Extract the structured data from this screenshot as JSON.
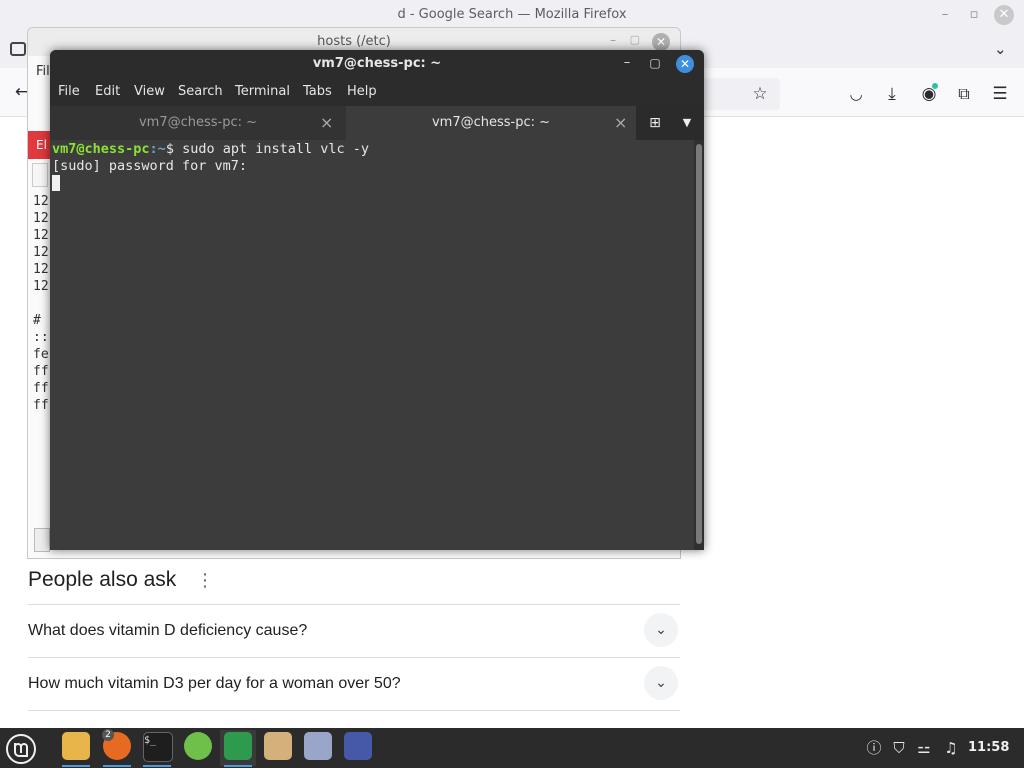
{
  "firefox": {
    "window_title": "d - Google Search — Mozilla Firefox",
    "people_also_ask": {
      "title": "People also ask",
      "questions": [
        "What does vitamin D deficiency cause?",
        "How much vitamin D3 per day for a woman over 50?"
      ]
    }
  },
  "hosts_window": {
    "title": "hosts (/etc)",
    "menu_partial": "Fil",
    "red_tab_partial": "El",
    "lines": [
      "12",
      "12",
      "12",
      "12",
      "12",
      "12",
      "",
      "# ",
      "::",
      "fe",
      "ff",
      "ff",
      "ff"
    ]
  },
  "terminal": {
    "title": "vm7@chess-pc: ~",
    "menu": [
      "File",
      "Edit",
      "View",
      "Search",
      "Terminal",
      "Tabs",
      "Help"
    ],
    "tabs": [
      {
        "label": "vm7@chess-pc: ~",
        "active": false
      },
      {
        "label": "vm7@chess-pc: ~",
        "active": true
      }
    ],
    "prompt_user": "vm7@chess-pc",
    "prompt_path": ":~",
    "prompt_symbol": "$ ",
    "command": "sudo apt install vlc -y",
    "output_line": "[sudo] password for vm7:"
  },
  "taskbar": {
    "firefox_badge": "2",
    "clock": "11:58",
    "apps": [
      "menu-icon",
      "files-icon",
      "firefox-icon",
      "terminal-icon",
      "spreadsheet-icon",
      "shield-icon",
      "archive-icon",
      "text-editor-icon",
      "media-player-icon"
    ]
  },
  "colors": {
    "terminal_bg": "#3c3c3c",
    "prompt_user": "#8ae234",
    "prompt_path": "#729fcf",
    "taskbar_bg": "#2b2b2b",
    "accent": "#3d8fe0"
  }
}
